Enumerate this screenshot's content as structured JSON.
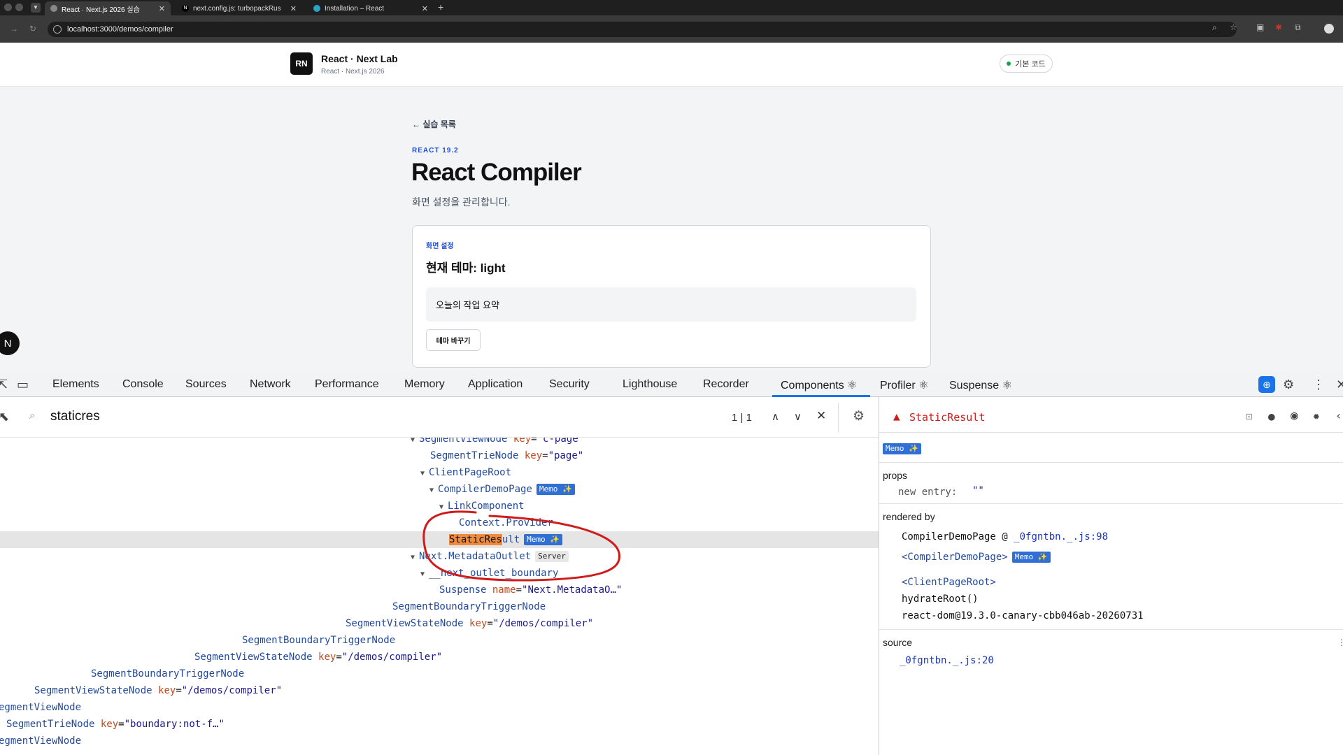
{
  "browser": {
    "tabs": [
      {
        "title": "React · Next.js 2026 실습",
        "favicon": "globe-icon",
        "active": true
      },
      {
        "title": "next.config.js: turbopackRus",
        "favicon": "N",
        "active": false
      },
      {
        "title": "Installation – React",
        "favicon": "react-icon",
        "active": false
      }
    ],
    "url": "localhost:3000/demos/compiler"
  },
  "page": {
    "brand_logo": "RN",
    "brand_title": "React · Next Lab",
    "brand_subtitle": "React · Next.js 2026",
    "badge_label": "기본 코드",
    "back_link": "← 실습 목록",
    "version": "REACT 19.2",
    "title": "React Compiler",
    "subtitle": "화면 설정을 관리합니다.",
    "card": {
      "label": "화면 설정",
      "title": "현재 테마: light",
      "summary": "오늘의 작업 요약",
      "button": "테마 바꾸기"
    },
    "next_badge": "N"
  },
  "devtools": {
    "tabs": [
      "Elements",
      "Console",
      "Sources",
      "Network",
      "Performance",
      "Memory",
      "Application",
      "Security",
      "Lighthouse",
      "Recorder",
      "Components ⚛",
      "Profiler ⚛",
      "Suspense ⚛"
    ],
    "active_tab": "Components ⚛",
    "search_value": "staticres",
    "search_count": "1 | 1",
    "memo_label": "Memo ✨",
    "server_label": "Server",
    "tree": [
      {
        "name": "SegmentViewNode",
        "key": "c-page"
      },
      {
        "name": "SegmentTrieNode",
        "key": "page"
      },
      {
        "name": "ClientPageRoot"
      },
      {
        "name": "CompilerDemoPage",
        "badge": "Memo ✨"
      },
      {
        "name": "LinkComponent"
      },
      {
        "name": "Context.Provider"
      },
      {
        "name_hl": "StaticRes",
        "name_rest": "ult",
        "badge": "Memo ✨"
      },
      {
        "name": "Next.MetadataOutlet",
        "badge": "Server"
      },
      {
        "name": "__next_outlet_boundary__"
      },
      {
        "name": "Suspense",
        "attr": "name",
        "value": "Next.MetadataO…"
      },
      {
        "name": "SegmentBoundaryTriggerNode"
      },
      {
        "name": "SegmentViewStateNode",
        "key": "/demos/compiler"
      },
      {
        "name": "SegmentBoundaryTriggerNode"
      },
      {
        "name": "SegmentViewStateNode",
        "key": "/demos/compiler"
      },
      {
        "name": "SegmentBoundaryTriggerNode"
      },
      {
        "name": "SegmentViewStateNode",
        "key": "/demos/compiler"
      },
      {
        "name": "egmentViewNode"
      },
      {
        "name": "SegmentTrieNode",
        "key": "boundary:not-f…"
      },
      {
        "name": "egmentViewNode"
      }
    ],
    "side": {
      "component": "StaticResult",
      "memo": "Memo ✨",
      "props_label": "props",
      "new_entry_label": "new entry:",
      "new_entry_value": "\"\"",
      "rendered_by_label": "rendered by",
      "rendered_by_line": "CompilerDemoPage @ ",
      "rendered_by_link": "_0fgntbn._.js:98",
      "owner1": "<CompilerDemoPage>",
      "owner2": "<ClientPageRoot>",
      "hydrate": "hydrateRoot()",
      "react_dom": "react-dom@19.3.0-canary-cbb046ab-20260731",
      "source_label": "source",
      "source_link": "_0fgntbn._.js:20"
    }
  },
  "colors": {
    "accent": "#1a73e8",
    "memo_badge": "#2f6fd6",
    "highlight": "#f08a3c",
    "annotation": "#d11a1a"
  }
}
